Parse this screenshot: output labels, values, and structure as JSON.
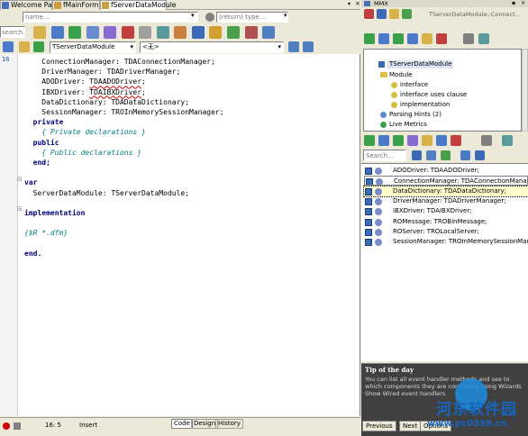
{
  "tabs": [
    {
      "label": "Welcome Page"
    },
    {
      "label": "fMainForm"
    },
    {
      "label": "fServerDataModule"
    }
  ],
  "toolbar": {
    "name_placeholder": "name...",
    "return_placeholder": "(return) type...",
    "search_placeholder": "search..."
  },
  "editor_selector": {
    "unit": "TServerDataModule",
    "section": "<无>"
  },
  "code": {
    "line_number": "16",
    "lines": [
      {
        "text": "    ConnectionManager: TDAConnectionManager;",
        "cls": ""
      },
      {
        "text": "    DriverManager: TDADriverManager;",
        "cls": ""
      },
      {
        "text": "    ADODriver: TDAADODriver;",
        "cls": ""
      },
      {
        "text": "    IBXDriver: TDAIBXDriver;",
        "cls": ""
      },
      {
        "text": "    DataDictionary: TDADataDictionary;",
        "cls": ""
      },
      {
        "text": "    SessionManager: TROInMemorySessionManager;",
        "cls": ""
      },
      {
        "text": "  private",
        "cls": "kw"
      },
      {
        "text": "    { Private declarations }",
        "cls": "cm"
      },
      {
        "text": "  public",
        "cls": "kw"
      },
      {
        "text": "    { Public declarations }",
        "cls": "cm"
      },
      {
        "text": "  end;",
        "cls": "kw"
      },
      {
        "text": "",
        "cls": ""
      },
      {
        "text": "var",
        "cls": "kw"
      },
      {
        "text": "  ServerDataModule: TServerDataModule;",
        "cls": ""
      },
      {
        "text": "",
        "cls": ""
      },
      {
        "text": "implementation",
        "cls": "kw"
      },
      {
        "text": "",
        "cls": ""
      },
      {
        "text": "{$R *.dfm}",
        "cls": "cm"
      },
      {
        "text": "",
        "cls": ""
      },
      {
        "text": "end.",
        "cls": "kw"
      }
    ]
  },
  "panel": {
    "title": "MMX",
    "breadcrumb": "TServerDataModule::Connect...",
    "tree": {
      "selected": "TServerDataModule",
      "module": "Module",
      "interface": "interface",
      "interface_uses": "interface uses clause",
      "implementation": "implementation",
      "parsing_hints": "Parsing Hints (2)",
      "live_metrics": "Live Metrics"
    },
    "search_placeholder": "Search...",
    "members": [
      "ADODriver: TDAADODriver;",
      "ConnectionManager: TDAConnectionManager",
      "DataDictionary: TDADataDictionary;",
      "DriverManager: TDADriverManager;",
      "IBXDriver: TDAIBXDriver;",
      "ROMessage: TROBinMessage;",
      "ROServer: TROLocalServer;",
      "SessionManager: TROInMemorySessionManager"
    ]
  },
  "tip": {
    "title": "Tip of the day",
    "text": "You can list all event handler methods and see to which components they are connected using Wizards Show Wired event handlers",
    "prev": "Previous",
    "next": "Next",
    "options": "Options"
  },
  "status": {
    "position": "16:  5",
    "mode": "Insert",
    "tab_code": "Code",
    "tab_design": "Design",
    "tab_history": "History"
  },
  "watermark": {
    "brand": "河东软件园",
    "url": "www.pc0359.cn"
  },
  "colors": {
    "keyword": "#000080",
    "comment": "#008080",
    "error_underline": "#d00000",
    "selection": "#ffffcc",
    "accent": "#3a6ab5"
  }
}
